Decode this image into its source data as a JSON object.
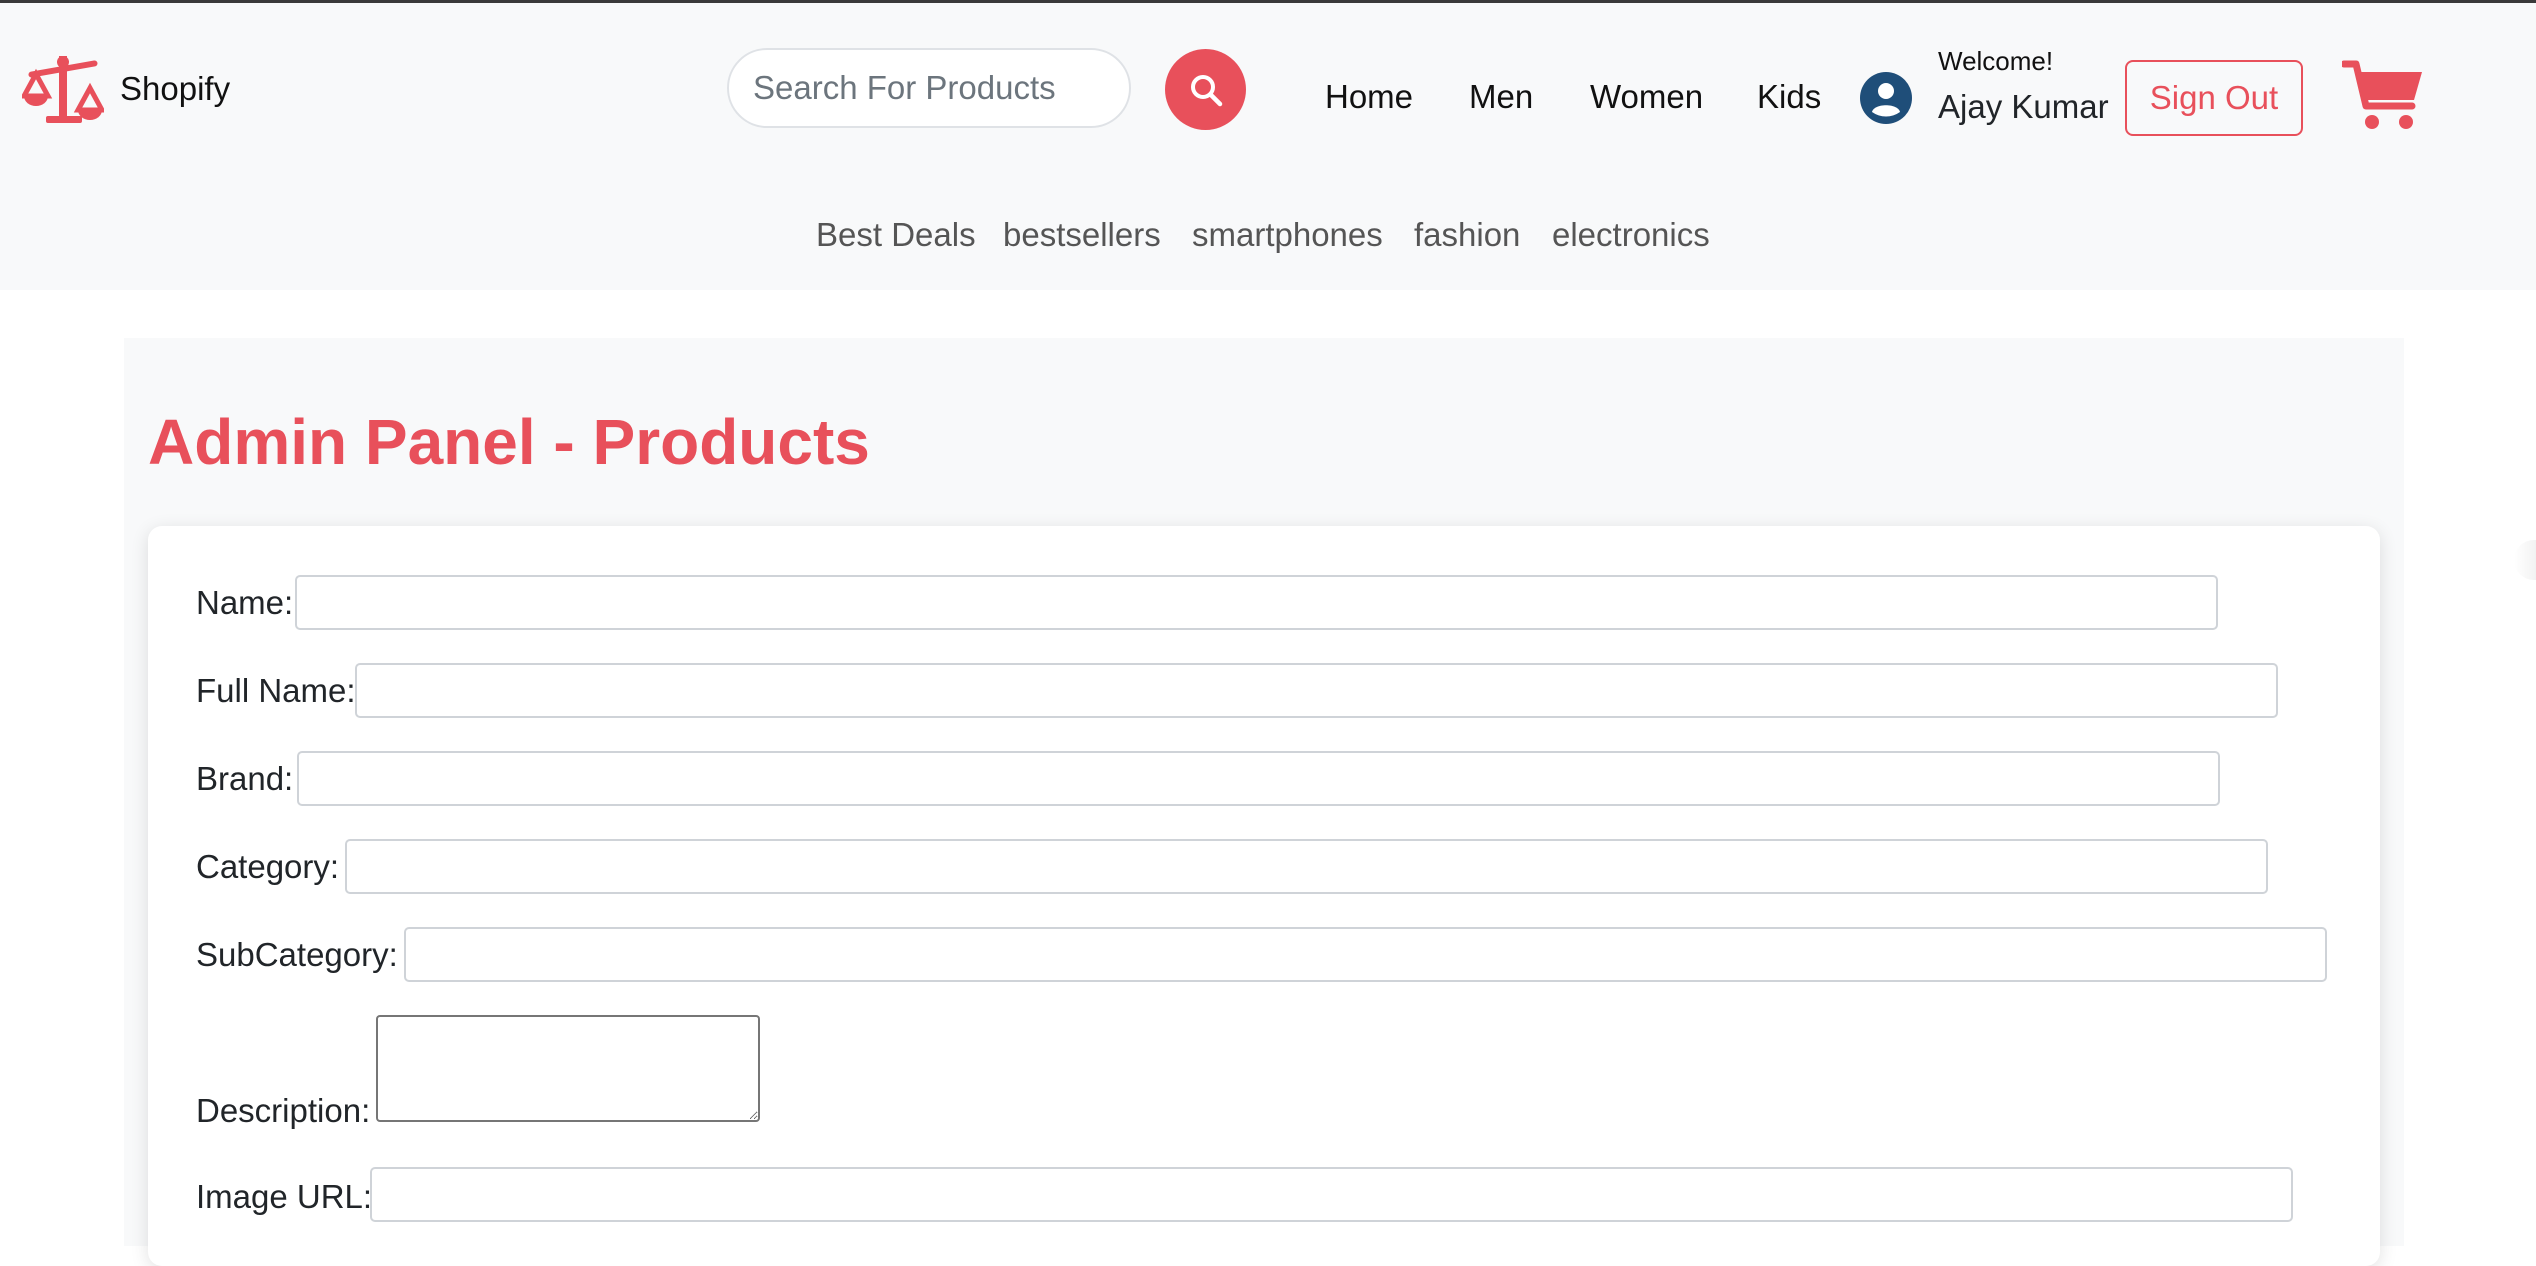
{
  "header": {
    "brand_name": "Shopify",
    "search": {
      "placeholder": "Search For Products",
      "value": ""
    },
    "nav": [
      "Home",
      "Men",
      "Women",
      "Kids"
    ],
    "user": {
      "welcome": "Welcome!",
      "name": "Ajay Kumar"
    },
    "sign_out_label": "Sign Out",
    "categories": [
      "Best Deals",
      "bestsellers",
      "smartphones",
      "fashion",
      "electronics"
    ]
  },
  "main": {
    "title": "Admin Panel - Products",
    "form": {
      "fields": [
        {
          "label": "Name:",
          "value": ""
        },
        {
          "label": "Full Name:",
          "value": ""
        },
        {
          "label": "Brand:",
          "value": ""
        },
        {
          "label": "Category:",
          "value": ""
        },
        {
          "label": "SubCategory:",
          "value": ""
        },
        {
          "label": "Description:",
          "value": ""
        },
        {
          "label": "Image URL:",
          "value": ""
        }
      ]
    }
  },
  "colors": {
    "accent": "#e8505b",
    "user_icon": "#1f4e79",
    "header_bg": "#f8f9fa"
  },
  "icons": [
    "scale-icon",
    "search-icon",
    "user-icon",
    "cart-icon"
  ]
}
